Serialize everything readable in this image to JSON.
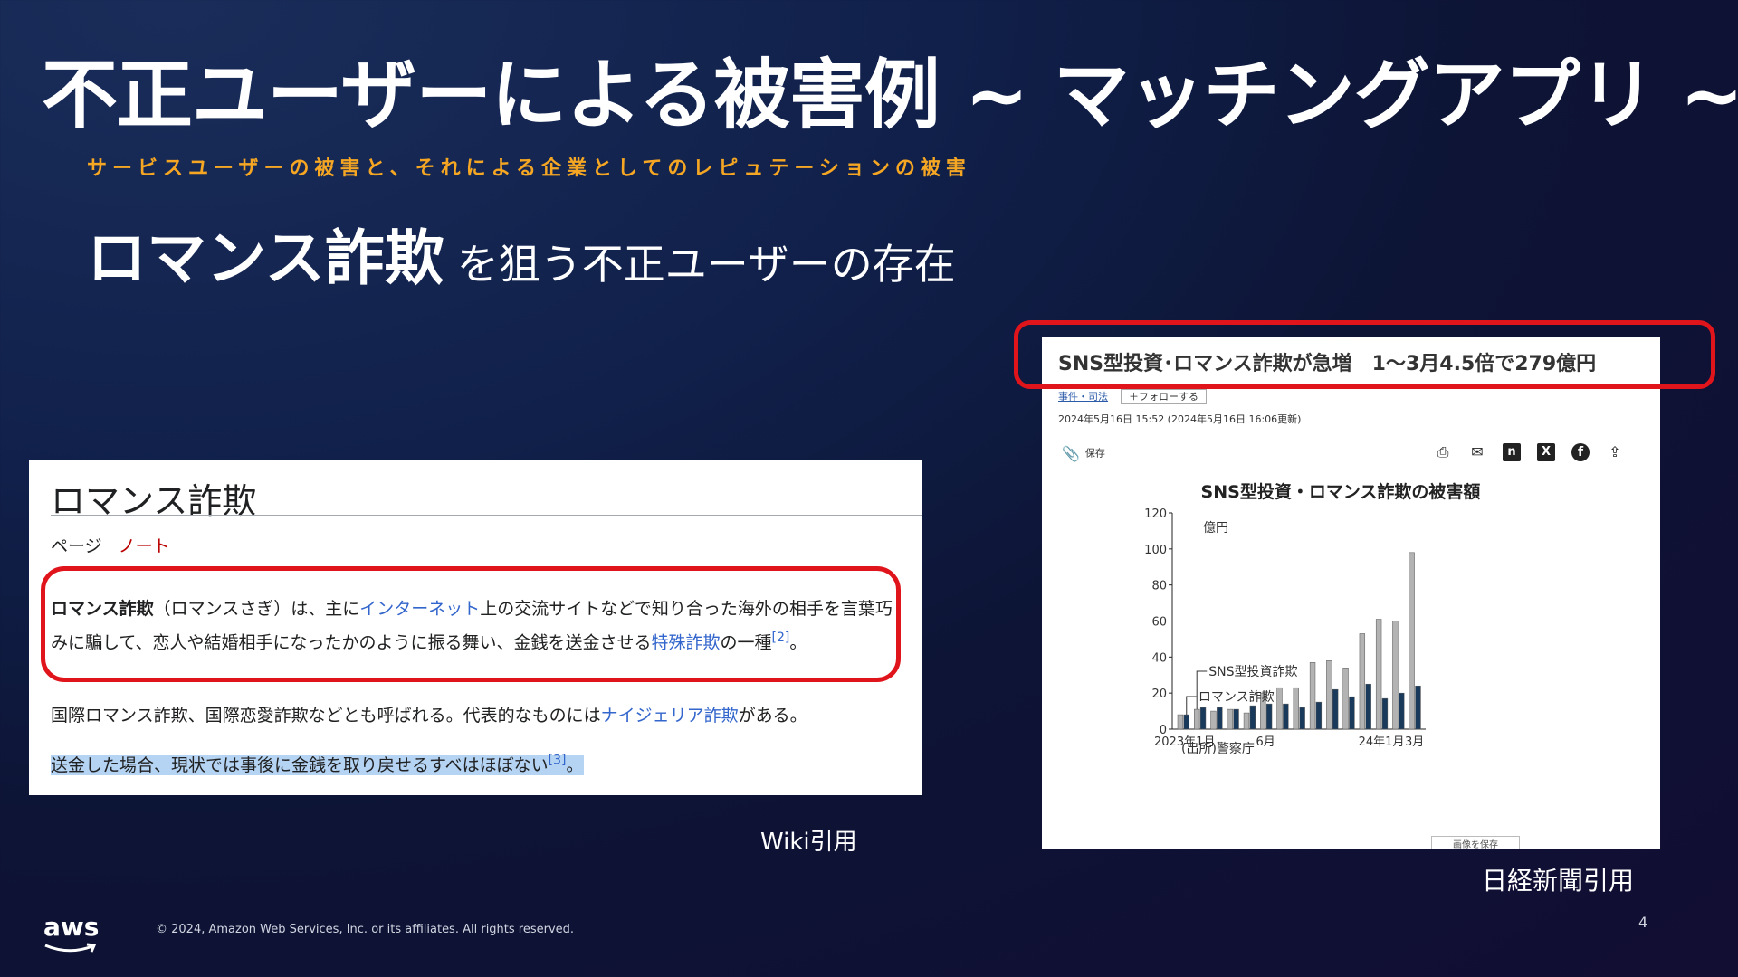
{
  "slide": {
    "title": "不正ユーザーによる被害例 ~ マッチングアプリ ~",
    "subtitle": "サービスユーザーの被害と、それによる企業としてのレピュテーションの被害",
    "headline_strong": "ロマンス詐欺",
    "headline_rest": "を狙う不正ユーザーの存在",
    "page_number": "4",
    "copyright": "© 2024, Amazon Web Services, Inc. or its affiliates. All rights reserved.",
    "logo_text": "aws"
  },
  "wiki": {
    "title": "ロマンス詐欺",
    "tab_page": "ページ",
    "tab_note": "ノート",
    "p1_bold": "ロマンス詐欺",
    "p1_a": "（ロマンスさぎ）は、主に",
    "p1_link1": "インターネット",
    "p1_b": "上の交流サイトなどで知り合った海外の相手を言葉巧みに騙して、恋人や結婚相手になったかのように振る舞い、金銭を送金させる",
    "p1_link2": "特殊詐欺",
    "p1_c": "の一種",
    "p1_ref": "[2]",
    "p1_end": "。",
    "p2_a": "国際ロマンス詐欺、国際恋愛詐欺などとも呼ばれる。代表的なものには",
    "p2_link": "ナイジェリア詐欺",
    "p2_b": "がある。",
    "p3_text": "送金した場合、現状では事後に金銭を取り戻せるすべはほぼない",
    "p3_ref": "[3]",
    "p3_end": "。",
    "caption": "Wiki引用"
  },
  "nikkei": {
    "headline": "SNS型投資･ロマンス詐欺が急増　1〜3月4.5倍で279億円",
    "category": "事件・司法",
    "follow": "＋フォローする",
    "date": "2024年5月16日 15:52 (2024年5月16日 16:06更新)",
    "save": "保存",
    "icons": [
      "print-icon",
      "mail-icon",
      "note-icon",
      "x-icon",
      "facebook-icon",
      "share-icon"
    ],
    "download": "画像を保存",
    "caption": "日経新聞引用"
  },
  "chart_data": {
    "type": "bar",
    "title": "SNS型投資・ロマンス詐欺の被害額",
    "ylabel": "億円",
    "ylim": [
      0,
      120
    ],
    "yticks": [
      0,
      20,
      40,
      60,
      80,
      100,
      120
    ],
    "x_tick_labels": [
      {
        "index": 0,
        "label": "2023年1月"
      },
      {
        "index": 5,
        "label": "6月"
      },
      {
        "index": 12,
        "label": "24年1月"
      },
      {
        "index": 14,
        "label": "3月"
      }
    ],
    "source": "(出所)警察庁",
    "categories": [
      "2023-01",
      "2023-02",
      "2023-03",
      "2023-04",
      "2023-05",
      "2023-06",
      "2023-07",
      "2023-08",
      "2023-09",
      "2023-10",
      "2023-11",
      "2023-12",
      "2024-01",
      "2024-02",
      "2024-03"
    ],
    "series": [
      {
        "name": "SNS型投資詐欺",
        "color": "#b3b3b3",
        "values": [
          8,
          11,
          10,
          11,
          9,
          20,
          23,
          23,
          37,
          38,
          34,
          53,
          61,
          60,
          98
        ]
      },
      {
        "name": "ロマンス詐欺",
        "color": "#1a3a5c",
        "values": [
          8,
          12,
          12,
          11,
          13,
          14,
          14,
          12,
          15,
          22,
          18,
          25,
          17,
          20,
          24
        ]
      }
    ],
    "grid": false,
    "legend": "inline-left"
  },
  "colors": {
    "accent_orange": "#f5a623",
    "highlight_red": "#e0141b",
    "link_blue": "#3366cc"
  }
}
